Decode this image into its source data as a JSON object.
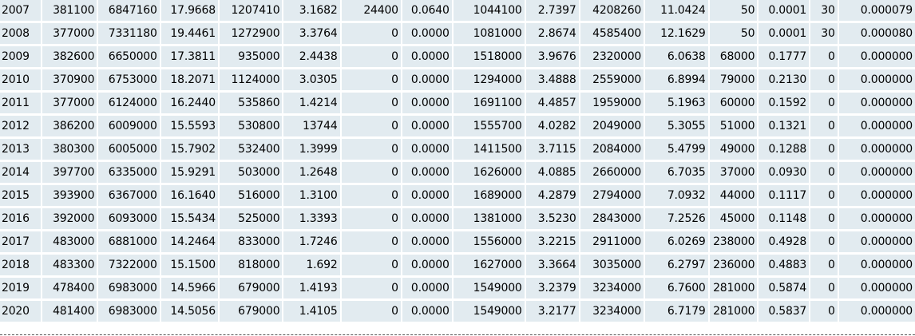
{
  "table": {
    "rows": [
      [
        "2007",
        "381100",
        "6847160",
        "17.9668",
        "1207410",
        "3.1682",
        "24400",
        "0.0640",
        "1044100",
        "2.7397",
        "4208260",
        "11.0424",
        "50",
        "0.0001",
        "30",
        "0.000079"
      ],
      [
        "2008",
        "377000",
        "7331180",
        "19.4461",
        "1272900",
        "3.3764",
        "0",
        "0.0000",
        "1081000",
        "2.8674",
        "4585400",
        "12.1629",
        "50",
        "0.0001",
        "30",
        "0.000080"
      ],
      [
        "2009",
        "382600",
        "6650000",
        "17.3811",
        "935000",
        "2.4438",
        "0",
        "0.0000",
        "1518000",
        "3.9676",
        "2320000",
        "6.0638",
        "68000",
        "0.1777",
        "0",
        "0.000000"
      ],
      [
        "2010",
        "370900",
        "6753000",
        "18.2071",
        "1124000",
        "3.0305",
        "0",
        "0.0000",
        "1294000",
        "3.4888",
        "2559000",
        "6.8994",
        "79000",
        "0.2130",
        "0",
        "0.000000"
      ],
      [
        "2011",
        "377000",
        "6124000",
        "16.2440",
        "535860",
        "1.4214",
        "0",
        "0.0000",
        "1691100",
        "4.4857",
        "1959000",
        "5.1963",
        "60000",
        "0.1592",
        "0",
        "0.000000"
      ],
      [
        "2012",
        "386200",
        "6009000",
        "15.5593",
        "530800",
        "13744",
        "0",
        "0.0000",
        "1555700",
        "4.0282",
        "2049000",
        "5.3055",
        "51000",
        "0.1321",
        "0",
        "0.000000"
      ],
      [
        "2013",
        "380300",
        "6005000",
        "15.7902",
        "532400",
        "1.3999",
        "0",
        "0.0000",
        "1411500",
        "3.7115",
        "2084000",
        "5.4799",
        "49000",
        "0.1288",
        "0",
        "0.000000"
      ],
      [
        "2014",
        "397700",
        "6335000",
        "15.9291",
        "503000",
        "1.2648",
        "0",
        "0.0000",
        "1626000",
        "4.0885",
        "2660000",
        "6.7035",
        "37000",
        "0.0930",
        "0",
        "0.000000"
      ],
      [
        "2015",
        "393900",
        "6367000",
        "16.1640",
        "516000",
        "1.3100",
        "0",
        "0.0000",
        "1689000",
        "4.2879",
        "2794000",
        "7.0932",
        "44000",
        "0.1117",
        "0",
        "0.000000"
      ],
      [
        "2016",
        "392000",
        "6093000",
        "15.5434",
        "525000",
        "1.3393",
        "0",
        "0.0000",
        "1381000",
        "3.5230",
        "2843000",
        "7.2526",
        "45000",
        "0.1148",
        "0",
        "0.000000"
      ],
      [
        "2017",
        "483000",
        "6881000",
        "14.2464",
        "833000",
        "1.7246",
        "0",
        "0.0000",
        "1556000",
        "3.2215",
        "2911000",
        "6.0269",
        "238000",
        "0.4928",
        "0",
        "0.000000"
      ],
      [
        "2018",
        "483300",
        "7322000",
        "15.1500",
        "818000",
        "1.692",
        "0",
        "0.0000",
        "1627000",
        "3.3664",
        "3035000",
        "6.2797",
        "236000",
        "0.4883",
        "0",
        "0.000000"
      ],
      [
        "2019",
        "478400",
        "6983000",
        "14.5966",
        "679000",
        "1.4193",
        "0",
        "0.0000",
        "1549000",
        "3.2379",
        "3234000",
        "6.7600",
        "281000",
        "0.5874",
        "0",
        "0.000000"
      ],
      [
        "2020",
        "481400",
        "6983000",
        "14.5056",
        "679000",
        "1.4105",
        "0",
        "0.0000",
        "1549000",
        "3.2177",
        "3234000",
        "6.7179",
        "281000",
        "0.5837",
        "0",
        "0.000000"
      ]
    ]
  }
}
